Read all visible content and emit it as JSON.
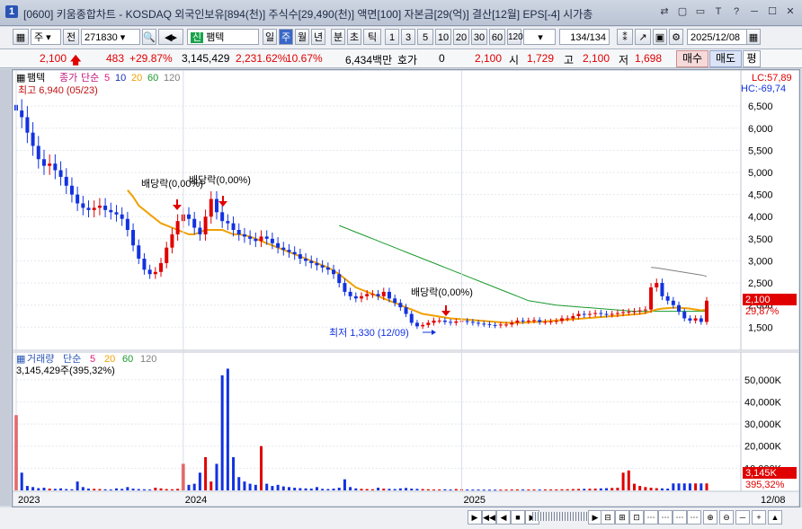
{
  "titlebar": {
    "number": "1",
    "title": "[0600] 키움종합차트 - KOSDAQ 외국인보유[894(천)] 주식수[29,490(천)] 액면[100] 자본금[29(억)] 결산[12월] EPS[-4] 시가총",
    "buttons": [
      "⇄",
      "▢",
      "▭",
      "T",
      "?",
      "─",
      "☐",
      "✕"
    ]
  },
  "toolbar": {
    "type": "주",
    "prev": "전",
    "code": "271830",
    "market_tag": "신",
    "name": "팸텍",
    "periods": [
      "일",
      "주",
      "월",
      "년",
      "분",
      "초",
      "틱"
    ],
    "selected_period": "주",
    "intervals": [
      "1",
      "3",
      "5",
      "10",
      "20",
      "30",
      "60",
      "120"
    ],
    "count": "134",
    "count_total": "/134",
    "date": "2025/12/08"
  },
  "quote": {
    "price": "2,100",
    "change": "483",
    "change_pct": "+29.87%",
    "volume": "3,145,429",
    "vol_ratio": "2,231.62%",
    "turnover": "10.67%",
    "amount": "6,434백만",
    "hoga_label": "호가",
    "hoga": "0",
    "hoga_price": "2,100",
    "open_label": "시",
    "open": "1,729",
    "high_label": "고",
    "high": "2,100",
    "low_label": "저",
    "low": "1,698",
    "buy": "매수",
    "sell": "매도",
    "flat": "평"
  },
  "colors": {
    "up": "#e00000",
    "down": "#1232e0",
    "ma5": "#e0187a",
    "ma10": "#1b2fb8",
    "ma20": "#f0a000",
    "ma60": "#189a2c",
    "ma120": "#808080",
    "bg": "#ffffff"
  },
  "chart_data": [
    {
      "type": "candlestick",
      "title": "팸텍",
      "legend": [
        "종가",
        "단순",
        "5",
        "10",
        "20",
        "60",
        "120"
      ],
      "y_ticks": [
        "6,500",
        "6,000",
        "5,500",
        "5,000",
        "4,500",
        "4,000",
        "3,500",
        "3,000",
        "2,500",
        "2,000",
        "1,500"
      ],
      "ylim": [
        1100,
        6950
      ],
      "high_note": "최고 6,940 (05/23)",
      "low_note": "최저 1,330 (12/09)",
      "dividend_labels": [
        "배당락(0,00%)",
        "배당락(0,00%)",
        "배당락(0,00%)"
      ],
      "lc": "LC:57,89",
      "hc": "HC:-69,74",
      "last_price": "2,100",
      "last_pct": "29,87%",
      "x_labels": [
        "2023",
        "2024",
        "2025"
      ],
      "close": [
        6400,
        6250,
        5900,
        5600,
        5300,
        5150,
        5200,
        5050,
        4900,
        4700,
        4500,
        4300,
        4200,
        4150,
        4200,
        4250,
        4150,
        4100,
        4050,
        3950,
        3700,
        3350,
        3050,
        2800,
        2700,
        2750,
        2950,
        3300,
        3600,
        3900,
        4050,
        3950,
        3750,
        3600,
        4000,
        4400,
        4100,
        3900,
        3850,
        3700,
        3600,
        3550,
        3500,
        3450,
        3550,
        3500,
        3400,
        3300,
        3250,
        3200,
        3150,
        3050,
        3000,
        2950,
        2900,
        2850,
        2800,
        2700,
        2500,
        2300,
        2200,
        2150,
        2200,
        2250,
        2250,
        2200,
        2300,
        2150,
        2050,
        1950,
        1800,
        1600,
        1520,
        1550,
        1600,
        1650,
        1650,
        1620,
        1600,
        1630,
        1640,
        1620,
        1600,
        1580,
        1570,
        1550,
        1540,
        1560,
        1560,
        1600,
        1650,
        1640,
        1650,
        1660,
        1620,
        1620,
        1630,
        1640,
        1700,
        1700,
        1750,
        1800,
        1780,
        1800,
        1820,
        1800,
        1790,
        1800,
        1820,
        1840,
        1850,
        1860,
        1880,
        1900,
        2400,
        2500,
        2200,
        2100,
        2000,
        1850,
        1700,
        1650,
        1700,
        1620,
        2100
      ],
      "ma20": [
        null,
        null,
        null,
        null,
        null,
        null,
        null,
        null,
        null,
        null,
        null,
        null,
        null,
        null,
        null,
        null,
        null,
        null,
        null,
        null,
        4600,
        4450,
        4250,
        4150,
        4050,
        3950,
        3850,
        3800,
        3750,
        3700,
        3650,
        3600,
        3600,
        3650,
        3700,
        3700,
        3700,
        3700,
        3650,
        3600,
        3600,
        3580,
        3550,
        3500,
        3450,
        3400,
        3350,
        3300,
        3250,
        3200,
        3150,
        3100,
        3050,
        3000,
        2950,
        2900,
        2850,
        2780,
        2700,
        2600,
        2500,
        2400,
        2350,
        2300,
        2250,
        2200,
        2150,
        2100,
        2050,
        2000,
        1950,
        1900,
        1850,
        1800,
        1780,
        1760,
        1740,
        1720,
        1700,
        1690,
        1680,
        1670,
        1660,
        1650,
        1640,
        1630,
        1620,
        1610,
        1600,
        1600,
        1600,
        1600,
        1610,
        1620,
        1620,
        1630,
        1640,
        1650,
        1660,
        1670,
        1680,
        1690,
        1700,
        1710,
        1720,
        1730,
        1740,
        1750,
        1760,
        1770,
        1780,
        1790,
        1800,
        1820,
        1860,
        1900,
        1920,
        1930,
        1940,
        1940,
        1930,
        1920,
        1900,
        1880,
        1900
      ],
      "ma60": [
        null,
        null,
        null,
        null,
        null,
        null,
        null,
        null,
        null,
        null,
        null,
        null,
        null,
        null,
        null,
        null,
        null,
        null,
        null,
        null,
        null,
        null,
        null,
        null,
        null,
        null,
        null,
        null,
        null,
        null,
        null,
        null,
        null,
        null,
        null,
        null,
        null,
        null,
        null,
        null,
        null,
        null,
        null,
        null,
        null,
        null,
        null,
        null,
        null,
        null,
        null,
        null,
        null,
        null,
        null,
        null,
        null,
        null,
        3800,
        3750,
        3700,
        3650,
        3600,
        3550,
        3500,
        3450,
        3400,
        3350,
        3300,
        3250,
        3200,
        3150,
        3100,
        3050,
        3000,
        2950,
        2900,
        2850,
        2800,
        2750,
        2700,
        2650,
        2600,
        2550,
        2500,
        2450,
        2400,
        2350,
        2300,
        2250,
        2200,
        2150,
        2100,
        2080,
        2060,
        2040,
        2020,
        2000,
        1990,
        1980,
        1970,
        1960,
        1950,
        1940,
        1930,
        1920,
        1910,
        1900,
        1890,
        1880,
        1870,
        1860,
        1860,
        1860,
        1860,
        1860,
        1860,
        1860,
        1860,
        1860,
        1860,
        1860,
        1860,
        1860,
        1860
      ],
      "ma120": [
        null,
        null,
        null,
        null,
        null,
        null,
        null,
        null,
        null,
        null,
        null,
        null,
        null,
        null,
        null,
        null,
        null,
        null,
        null,
        null,
        null,
        null,
        null,
        null,
        null,
        null,
        null,
        null,
        null,
        null,
        null,
        null,
        null,
        null,
        null,
        null,
        null,
        null,
        null,
        null,
        null,
        null,
        null,
        null,
        null,
        null,
        null,
        null,
        null,
        null,
        null,
        null,
        null,
        null,
        null,
        null,
        null,
        null,
        null,
        null,
        null,
        null,
        null,
        null,
        null,
        null,
        null,
        null,
        null,
        null,
        null,
        null,
        null,
        null,
        null,
        null,
        null,
        null,
        null,
        null,
        null,
        null,
        null,
        null,
        null,
        null,
        null,
        null,
        null,
        null,
        null,
        null,
        null,
        null,
        null,
        null,
        null,
        null,
        null,
        null,
        null,
        null,
        null,
        null,
        null,
        null,
        null,
        null,
        null,
        null,
        null,
        null,
        null,
        null,
        2850,
        2840,
        2820,
        2800,
        2780,
        2760,
        2740,
        2720,
        2700,
        2680,
        2650
      ]
    },
    {
      "type": "bar",
      "title": "거래량",
      "legend": [
        "거래량",
        "단순",
        "5",
        "20",
        "60",
        "120"
      ],
      "current": "3,145,429주(395,32%)",
      "y_ticks": [
        "50,000K",
        "40,000K",
        "30,000K",
        "20,000K",
        "10,000K"
      ],
      "ylim": [
        0,
        56000
      ],
      "last_volume": "3,145K",
      "last_pct": "395,32%",
      "date_label": "12/08",
      "values": [
        34000,
        8000,
        2000,
        1500,
        1000,
        1200,
        800,
        700,
        900,
        600,
        500,
        4000,
        1500,
        800,
        700,
        600,
        500,
        400,
        900,
        700,
        1500,
        800,
        600,
        500,
        400,
        1200,
        900,
        600,
        500,
        700,
        12000,
        2500,
        3000,
        8000,
        15000,
        4000,
        12000,
        52000,
        55000,
        15000,
        6000,
        4000,
        3000,
        2500,
        20000,
        3000,
        2000,
        2500,
        1800,
        1500,
        1200,
        1000,
        900,
        800,
        1500,
        700,
        600,
        800,
        1200,
        5000,
        1500,
        900,
        700,
        600,
        500,
        1200,
        800,
        700,
        600,
        900,
        1100,
        800,
        700,
        600,
        500,
        400,
        450,
        500,
        400,
        600,
        500,
        400,
        380,
        400,
        350,
        330,
        340,
        360,
        380,
        420,
        450,
        430,
        420,
        410,
        400,
        420,
        430,
        450,
        500,
        520,
        600,
        650,
        700,
        750,
        800,
        900,
        1000,
        1100,
        1200,
        8000,
        9000,
        3000,
        2000,
        1500,
        1200,
        1000,
        900,
        800,
        3145,
        3145,
        3145,
        3145,
        3145,
        3145,
        3145
      ]
    }
  ],
  "bottombar": {
    "nav": [
      "▶",
      "◀◀",
      "◀",
      "■",
      "▶"
    ],
    "icons": [
      "⊟",
      "⊞",
      "⊡",
      "⋯",
      "⋯",
      "⋯",
      "⋯",
      "⊕",
      "⊖",
      "─",
      "+",
      "▲"
    ]
  }
}
